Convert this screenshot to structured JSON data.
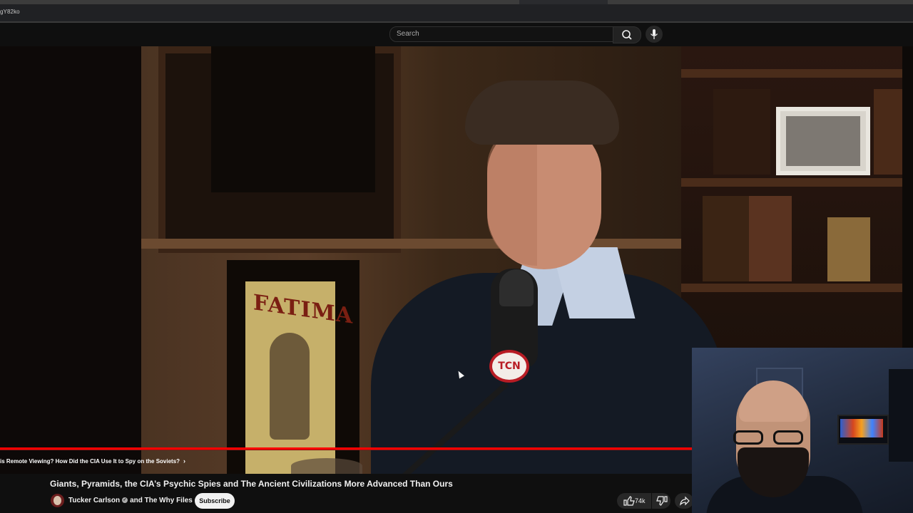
{
  "browser": {
    "url_fragment": "gY82ko"
  },
  "header": {
    "search_placeholder": "Search",
    "search_icon": "search-icon",
    "mic_icon": "microphone-icon"
  },
  "video": {
    "poster_text": "FATIMA",
    "mic_brand": "TCN",
    "progress_fraction": 1.0,
    "chapter_title": "is Remote Viewing? How Did the CIA Use It to Spy on the Soviets?"
  },
  "meta": {
    "title": "Giants, Pyramids, the CIA’s Psychic Spies and The Ancient Civilizations More Advanced Than Ours",
    "channel_primary": "Tucker Carlson",
    "channel_join": "and",
    "channel_secondary": "The Why Files",
    "subscribe_label": "Subscribe",
    "like_count": "74k",
    "icons": {
      "like": "thumbs-up-icon",
      "dislike": "thumbs-down-icon",
      "share": "share-icon",
      "verified": "verified-check-icon"
    }
  },
  "colors": {
    "progress": "#ff0000",
    "background": "#0f0f0f",
    "subscribe_bg": "#f1f1f1"
  }
}
